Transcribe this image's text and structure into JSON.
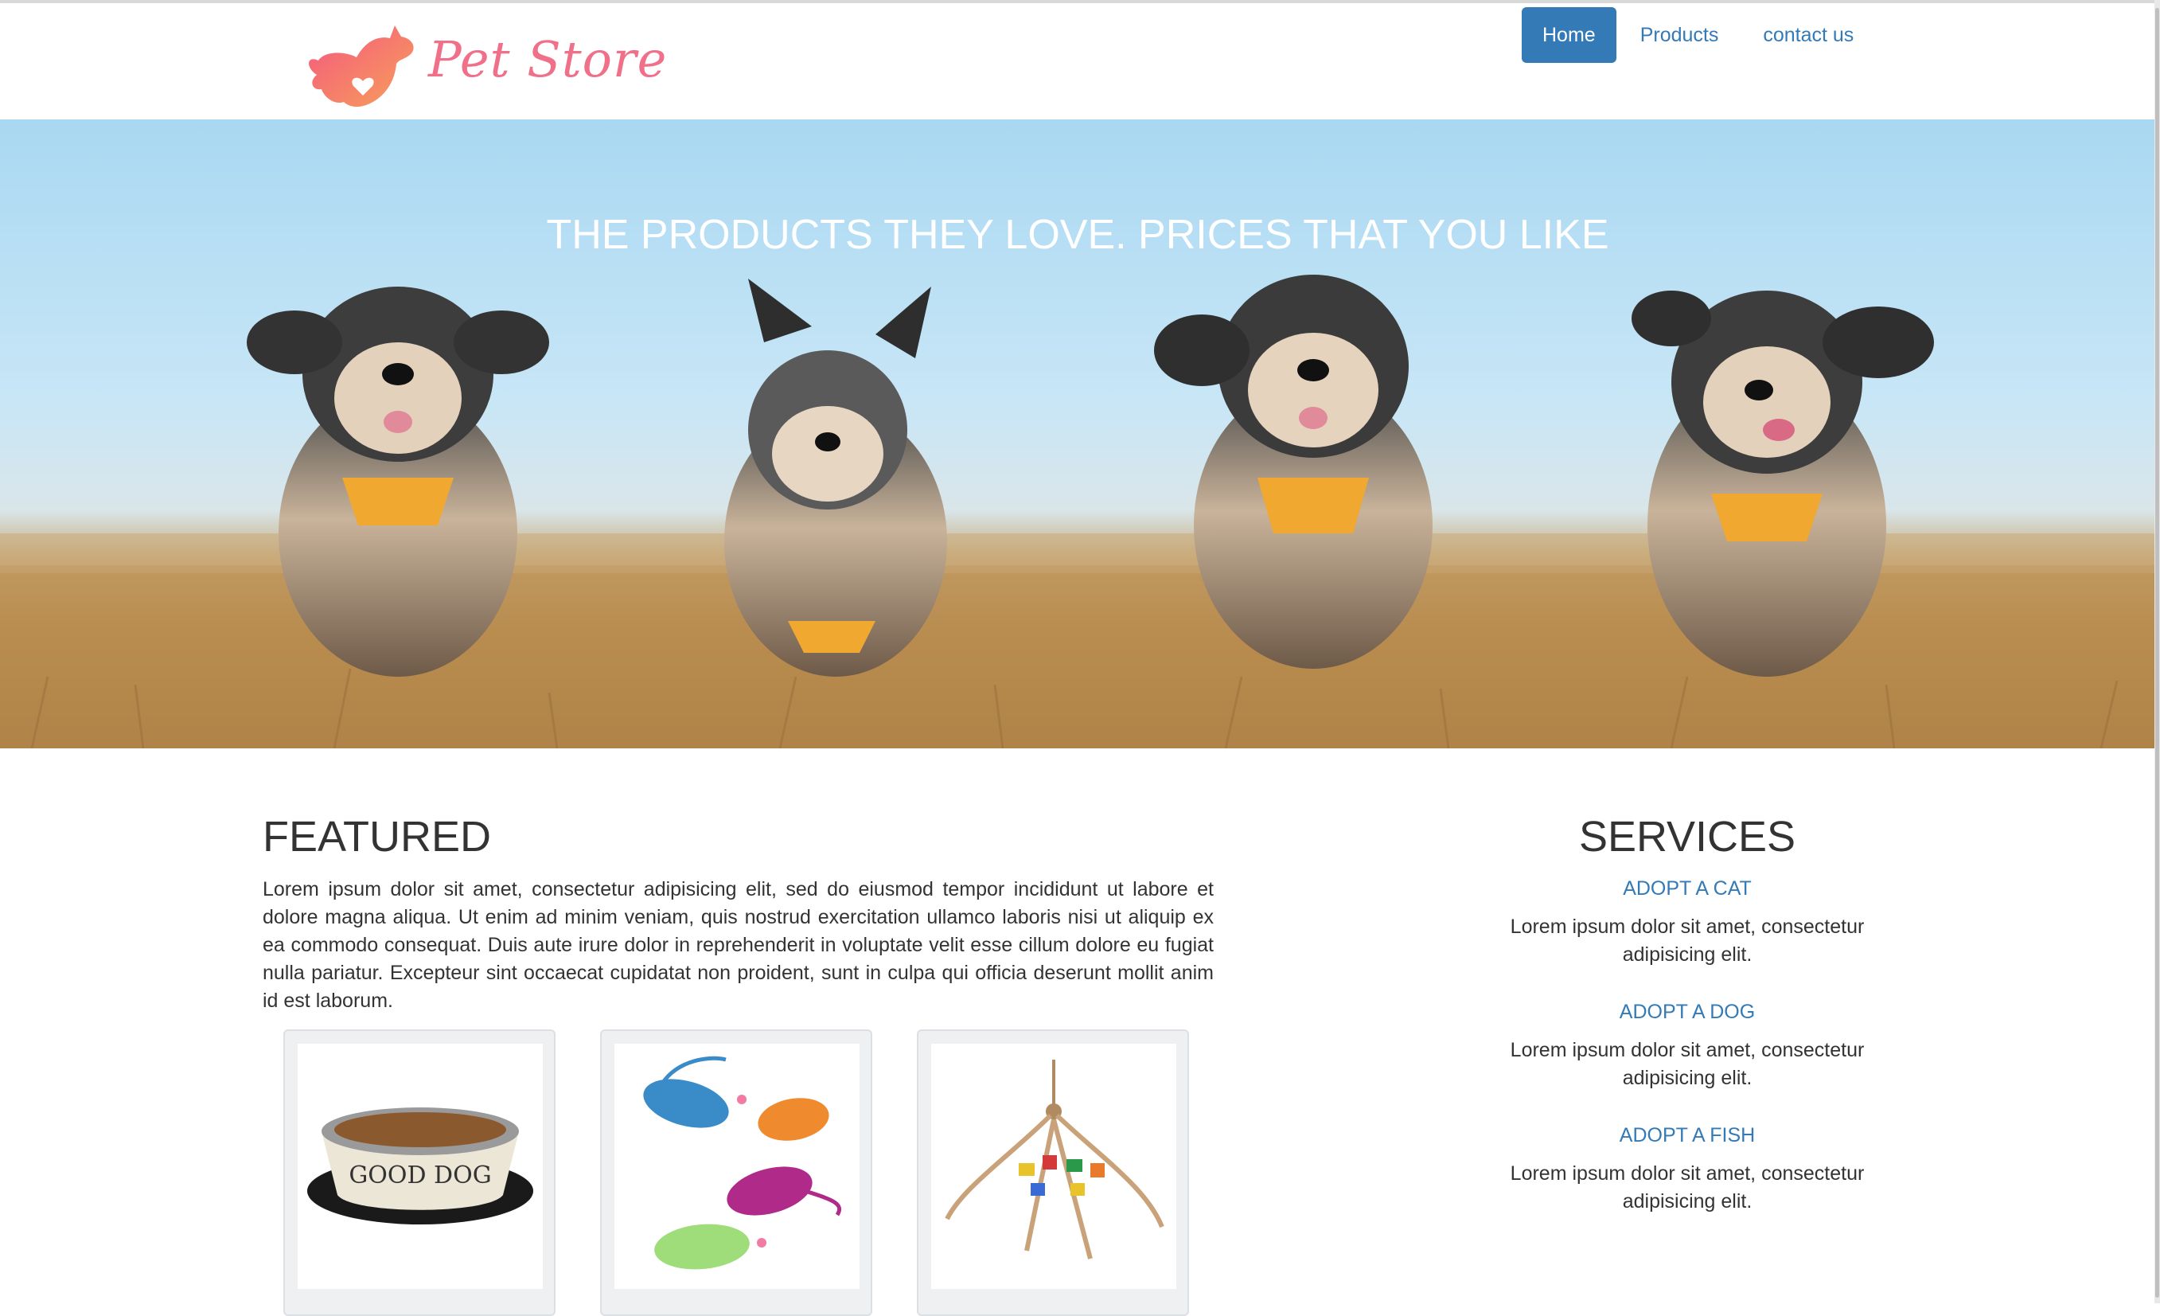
{
  "brand": {
    "name": "Pet Store"
  },
  "nav": {
    "items": [
      {
        "label": "Home",
        "active": true
      },
      {
        "label": "Products",
        "active": false
      },
      {
        "label": "contact us",
        "active": false
      }
    ]
  },
  "hero": {
    "title": "THE PRODUCTS THEY LOVE. PRICES THAT YOU LIKE"
  },
  "featured": {
    "title": "FEATURED",
    "text": "Lorem ipsum dolor sit amet, consectetur adipisicing elit, sed do eiusmod tempor incididunt ut labore et dolore magna aliqua. Ut enim ad minim veniam, quis nostrud exercitation ullamco laboris nisi ut aliquip ex ea commodo consequat. Duis aute irure dolor in reprehenderit in voluptate velit esse cillum dolore eu fugiat nulla pariatur. Excepteur sint occaecat cupidatat non proident, sunt in culpa qui officia deserunt mollit anim id est laborum.",
    "products": [
      {
        "bowl_text": "GOOD DOG"
      },
      {},
      {}
    ]
  },
  "services": {
    "title": "SERVICES",
    "items": [
      {
        "link": "ADOPT A CAT",
        "text": "Lorem ipsum dolor sit amet, consectetur adipisicing elit."
      },
      {
        "link": "ADOPT A DOG",
        "text": "Lorem ipsum dolor sit amet, consectetur adipisicing elit."
      },
      {
        "link": "ADOPT A FISH",
        "text": "Lorem ipsum dolor sit amet, consectetur adipisicing elit."
      }
    ]
  },
  "colors": {
    "accent": "#337ab7",
    "logo": "#f0708a",
    "text": "#333333"
  }
}
